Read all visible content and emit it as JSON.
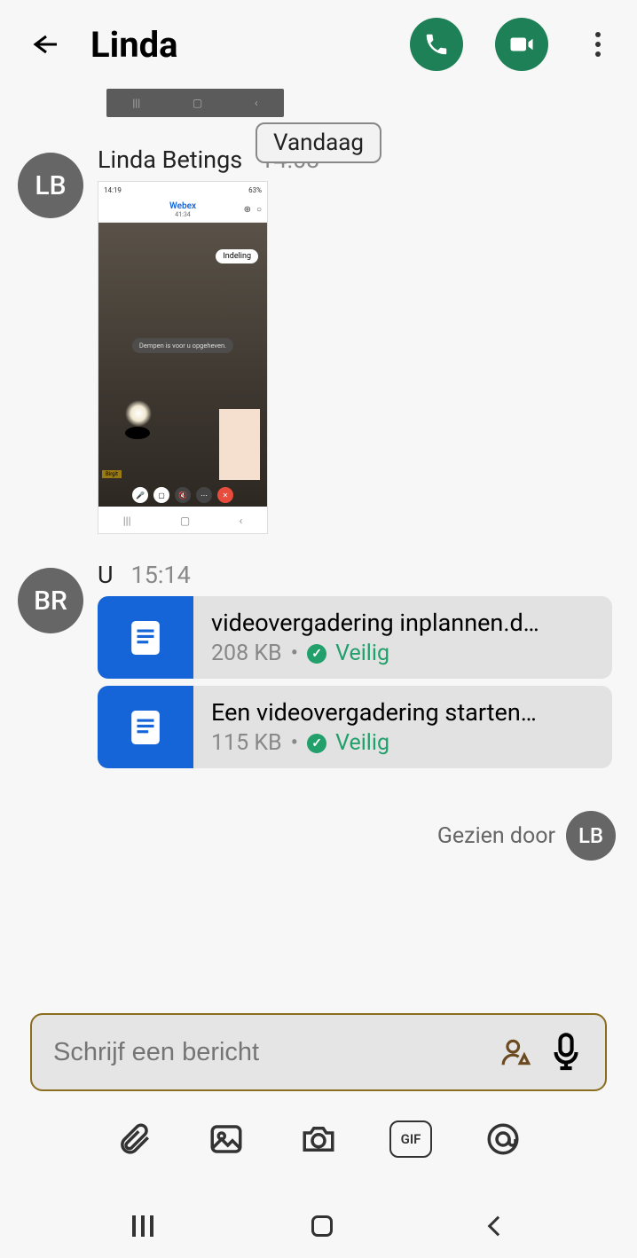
{
  "header": {
    "title": "Linda"
  },
  "day_divider": "Vandaag",
  "messages": [
    {
      "avatar": "LB",
      "sender": "Linda Betings",
      "time": "14:03",
      "shared_screenshot": {
        "statusbar_time": "14:19",
        "statusbar_battery": "63%",
        "app_title": "Webex",
        "app_timer": "41:34",
        "pill_label": "Indeling",
        "toast": "Dempen is voor u opgeheven.",
        "bottom_tag": "Birgit"
      }
    },
    {
      "avatar": "BR",
      "sender": "U",
      "time": "15:14",
      "files": [
        {
          "name": "videovergadering inplannen.d…",
          "size": "208 KB",
          "safe_label": "Veilig"
        },
        {
          "name": "Een videovergadering starten…",
          "size": "115 KB",
          "safe_label": "Veilig"
        }
      ]
    }
  ],
  "seen_by": {
    "label": "Gezien door",
    "avatar": "LB"
  },
  "composer": {
    "placeholder": "Schrijf een bericht"
  },
  "toolbar": {
    "gif_label": "GIF"
  }
}
